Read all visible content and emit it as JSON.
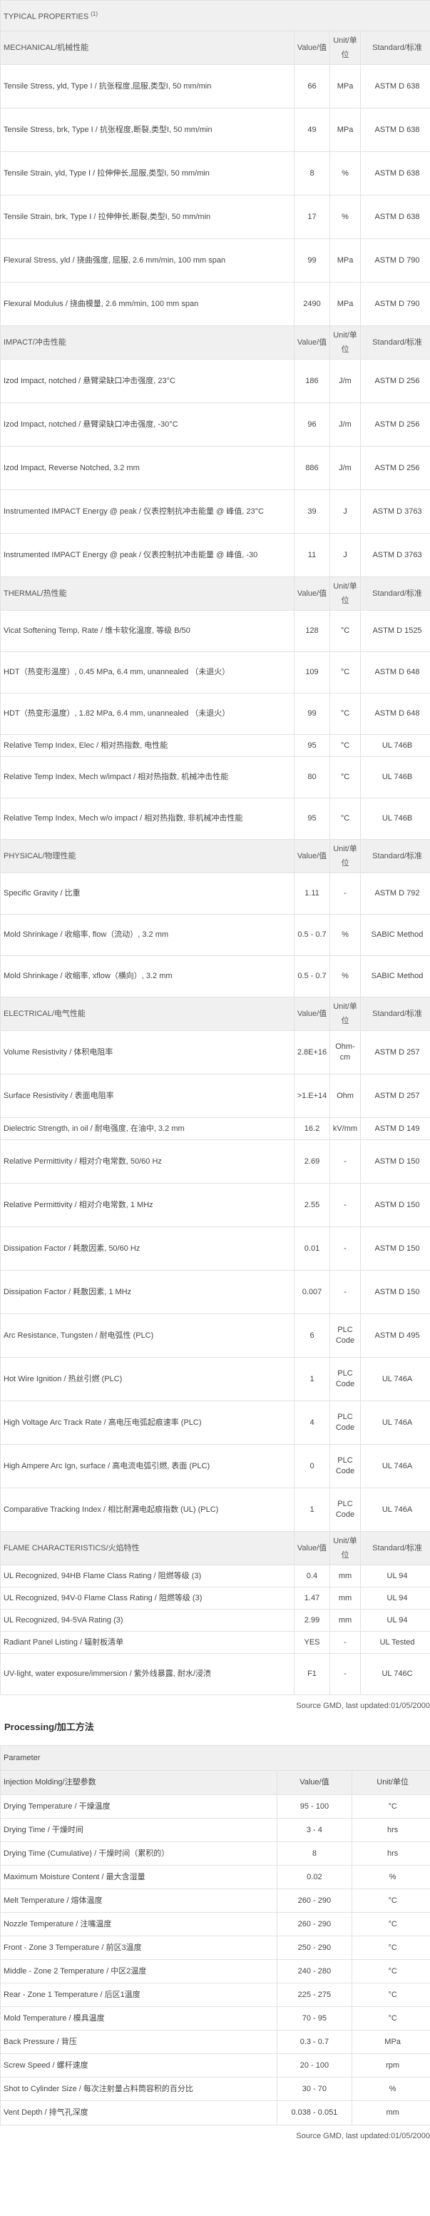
{
  "typical": {
    "title": "TYPICAL PROPERTIES",
    "title_sup": "(1)",
    "sections": [
      {
        "name": "MECHANICAL/机械性能",
        "value_header": "Value/值",
        "unit_header": "Unit/单位",
        "std_header": "Standard/标准",
        "rows": [
          {
            "name": "Tensile Stress, yld, Type I / 抗张程度,屈服,类型I, 50 mm/min",
            "value": "66",
            "unit": "MPa",
            "std": "ASTM D 638"
          },
          {
            "name": "Tensile Stress, brk, Type I / 抗张程度,断裂,类型I, 50 mm/min",
            "value": "49",
            "unit": "MPa",
            "std": "ASTM D 638"
          },
          {
            "name": "Tensile Strain, yld, Type I / 拉伸伸长,屈服,类型I, 50 mm/min",
            "value": "8",
            "unit": "%",
            "std": "ASTM D 638"
          },
          {
            "name": "Tensile Strain, brk, Type I / 拉伸伸长,断裂,类型I, 50 mm/min",
            "value": "17",
            "unit": "%",
            "std": "ASTM D 638"
          },
          {
            "name": "Flexural Stress, yld / 挠曲强度, 屈服, 2.6 mm/min, 100 mm span",
            "value": "99",
            "unit": "MPa",
            "std": "ASTM D 790"
          },
          {
            "name": "Flexural Modulus / 挠曲模量, 2.6 mm/min, 100 mm span",
            "value": "2490",
            "unit": "MPa",
            "std": "ASTM D 790"
          }
        ]
      },
      {
        "name": "IMPACT/冲击性能",
        "value_header": "Value/值",
        "unit_header": "Unit/单位",
        "std_header": "Standard/标准",
        "rows": [
          {
            "name": "Izod Impact, notched / 悬臂梁缺口冲击强度, 23°C",
            "value": "186",
            "unit": "J/m",
            "std": "ASTM D 256"
          },
          {
            "name": "Izod Impact, notched / 悬臂梁缺口冲击强度, -30°C",
            "value": "96",
            "unit": "J/m",
            "std": "ASTM D 256"
          },
          {
            "name": "Izod Impact, Reverse Notched, 3.2 mm",
            "value": "886",
            "unit": "J/m",
            "std": "ASTM D 256"
          },
          {
            "name": "Instrumented IMPACT Energy @ peak / 仪表控制抗冲击能量 @ 峰值, 23°C",
            "value": "39",
            "unit": "J",
            "std": "ASTM D 3763"
          },
          {
            "name": "Instrumented IMPACT Energy @ peak / 仪表控制抗冲击能量 @ 峰值, -30",
            "value": "11",
            "unit": "J",
            "std": "ASTM D 3763"
          }
        ]
      },
      {
        "name": "THERMAL/热性能",
        "value_header": "Value/值",
        "unit_header": "Unit/单位",
        "std_header": "Standard/标准",
        "rows": [
          {
            "name": "Vicat Softening Temp, Rate / 维卡软化温度, 等级 B/50",
            "value": "128",
            "unit": "°C",
            "std": "ASTM D 1525"
          },
          {
            "name": "HDT（热变形温度）, 0.45 MPa, 6.4 mm, unannealed （未退火）",
            "value": "109",
            "unit": "°C",
            "std": "ASTM D 648"
          },
          {
            "name": "HDT（热变形温度）, 1.82 MPa, 6.4 mm, unannealed （未退火）",
            "value": "99",
            "unit": "°C",
            "std": "ASTM D 648"
          },
          {
            "name": "Relative Temp Index, Elec / 相对热指数, 电性能",
            "value": "95",
            "unit": "°C",
            "std": "UL 746B"
          },
          {
            "name": "Relative Temp Index, Mech w/impact / 相对热指数, 机械冲击性能",
            "value": "80",
            "unit": "°C",
            "std": "UL 746B"
          },
          {
            "name": "Relative Temp Index, Mech w/o impact / 相对热指数, 非机械冲击性能",
            "value": "95",
            "unit": "°C",
            "std": "UL 746B"
          }
        ]
      },
      {
        "name": "PHYSICAL/物理性能",
        "value_header": "Value/值",
        "unit_header": "Unit/单位",
        "std_header": "Standard/标准",
        "rows": [
          {
            "name": "Specific Gravity / 比重",
            "value": "1.11",
            "unit": "-",
            "std": "ASTM D 792"
          },
          {
            "name": "Mold Shrinkage / 收缩率, flow（流动）, 3.2 mm",
            "value": "0.5 - 0.7",
            "unit": "%",
            "std": "SABIC Method"
          },
          {
            "name": "Mold Shrinkage / 收缩率, xflow（横向）, 3.2 mm",
            "value": "0.5 - 0.7",
            "unit": "%",
            "std": "SABIC Method"
          }
        ]
      },
      {
        "name": "ELECTRICAL/电气性能",
        "value_header": "Value/值",
        "unit_header": "Unit/单位",
        "std_header": "Standard/标准",
        "rows": [
          {
            "name": "Volume Resistivity / 体积电阻率",
            "value": "2.8E+16",
            "unit": "Ohm-cm",
            "std": "ASTM D 257"
          },
          {
            "name": "Surface Resistivity / 表面电阻率",
            "value": ">1.E+14",
            "unit": "Ohm",
            "std": "ASTM D 257"
          },
          {
            "name": "Dielectric Strength, in oil / 耐电强度, 在油中, 3.2 mm",
            "value": "16.2",
            "unit": "kV/mm",
            "std": "ASTM D 149"
          },
          {
            "name": "Relative Permittivity / 相对介电常数, 50/60 Hz",
            "value": "2.69",
            "unit": "-",
            "std": "ASTM D 150"
          },
          {
            "name": "Relative Permittivity / 相对介电常数, 1 MHz",
            "value": "2.55",
            "unit": "-",
            "std": "ASTM D 150"
          },
          {
            "name": "Dissipation Factor / 耗散因素, 50/60 Hz",
            "value": "0.01",
            "unit": "-",
            "std": "ASTM D 150"
          },
          {
            "name": "Dissipation Factor / 耗散因素, 1 MHz",
            "value": "0.007",
            "unit": "-",
            "std": "ASTM D 150"
          },
          {
            "name": "Arc Resistance, Tungsten / 耐电弧性 (PLC)",
            "value": "6",
            "unit": "PLC Code",
            "std": "ASTM D 495"
          },
          {
            "name": "Hot Wire Ignition / 热丝引燃 (PLC)",
            "value": "1",
            "unit": "PLC Code",
            "std": "UL 746A"
          },
          {
            "name": "High Voltage Arc Track Rate / 高电压电弧起痕速率 (PLC)",
            "value": "4",
            "unit": "PLC Code",
            "std": "UL 746A"
          },
          {
            "name": "High Ampere Arc Ign, surface / 高电流电弧引燃, 表面 (PLC)",
            "value": "0",
            "unit": "PLC Code",
            "std": "UL 746A"
          },
          {
            "name": "Comparative Tracking Index / 相比耐漏电起痕指数 (UL) (PLC)",
            "value": "1",
            "unit": "PLC Code",
            "std": "UL 746A"
          }
        ]
      },
      {
        "name": "FLAME CHARACTERISTICS/火焰特性",
        "value_header": "Value/值",
        "unit_header": "Unit/单位",
        "std_header": "Standard/标准",
        "rows": [
          {
            "name": "UL Recognized, 94HB Flame Class Rating / 阻燃等级 (3)",
            "value": "0.4",
            "unit": "mm",
            "std": "UL 94"
          },
          {
            "name": "UL Recognized, 94V-0 Flame Class Rating / 阻燃等级 (3)",
            "value": "1.47",
            "unit": "mm",
            "std": "UL 94"
          },
          {
            "name": "UL Recognized, 94-5VA Rating (3)",
            "value": "2.99",
            "unit": "mm",
            "std": "UL 94"
          },
          {
            "name": "Radiant Panel Listing / 辐射板清单",
            "value": "YES",
            "unit": "-",
            "std": "UL Tested"
          },
          {
            "name": "UV-light, water exposure/immersion / 紫外线暴露, 耐水/浸渍",
            "value": "F1",
            "unit": "-",
            "std": "UL 746C"
          }
        ]
      }
    ],
    "source": "Source GMD, last updated:01/05/2000"
  },
  "processing": {
    "title": "Processing/加工方法",
    "caption": "Parameter",
    "header": {
      "name": "Injection Molding/注塑参数",
      "value": "Value/值",
      "unit": "Unit/单位"
    },
    "rows": [
      {
        "name": "Drying Temperature / 干燥温度",
        "value": "95 - 100",
        "unit": "°C"
      },
      {
        "name": "Drying Time / 干燥时间",
        "value": "3 - 4",
        "unit": "hrs"
      },
      {
        "name": "Drying Time (Cumulative) / 干燥时间（累积的）",
        "value": "8",
        "unit": "hrs"
      },
      {
        "name": "Maximum Moisture Content / 最大含湿量",
        "value": "0.02",
        "unit": "%"
      },
      {
        "name": "Melt Temperature / 熔体温度",
        "value": "260 - 290",
        "unit": "°C"
      },
      {
        "name": "Nozzle Temperature / 注嘴温度",
        "value": "260 - 290",
        "unit": "°C"
      },
      {
        "name": "Front - Zone 3 Temperature / 前区3温度",
        "value": "250 - 290",
        "unit": "°C"
      },
      {
        "name": "Middle - Zone 2 Temperature / 中区2温度",
        "value": "240 - 280",
        "unit": "°C"
      },
      {
        "name": "Rear - Zone 1 Temperature / 后区1温度",
        "value": "225 - 275",
        "unit": "°C"
      },
      {
        "name": "Mold Temperature / 模具温度",
        "value": "70 - 95",
        "unit": "°C"
      },
      {
        "name": "Back Pressure / 背压",
        "value": "0.3 - 0.7",
        "unit": "MPa"
      },
      {
        "name": "Screw Speed / 螺杆速度",
        "value": "20 - 100",
        "unit": "rpm"
      },
      {
        "name": "Shot to Cylinder Size / 每次注射量占料筒容积的百分比",
        "value": "30 - 70",
        "unit": "%"
      },
      {
        "name": "Vent Depth / 排气孔深度",
        "value": "0.038 - 0.051",
        "unit": "mm"
      }
    ],
    "source": "Source GMD, last updated:01/05/2000"
  }
}
